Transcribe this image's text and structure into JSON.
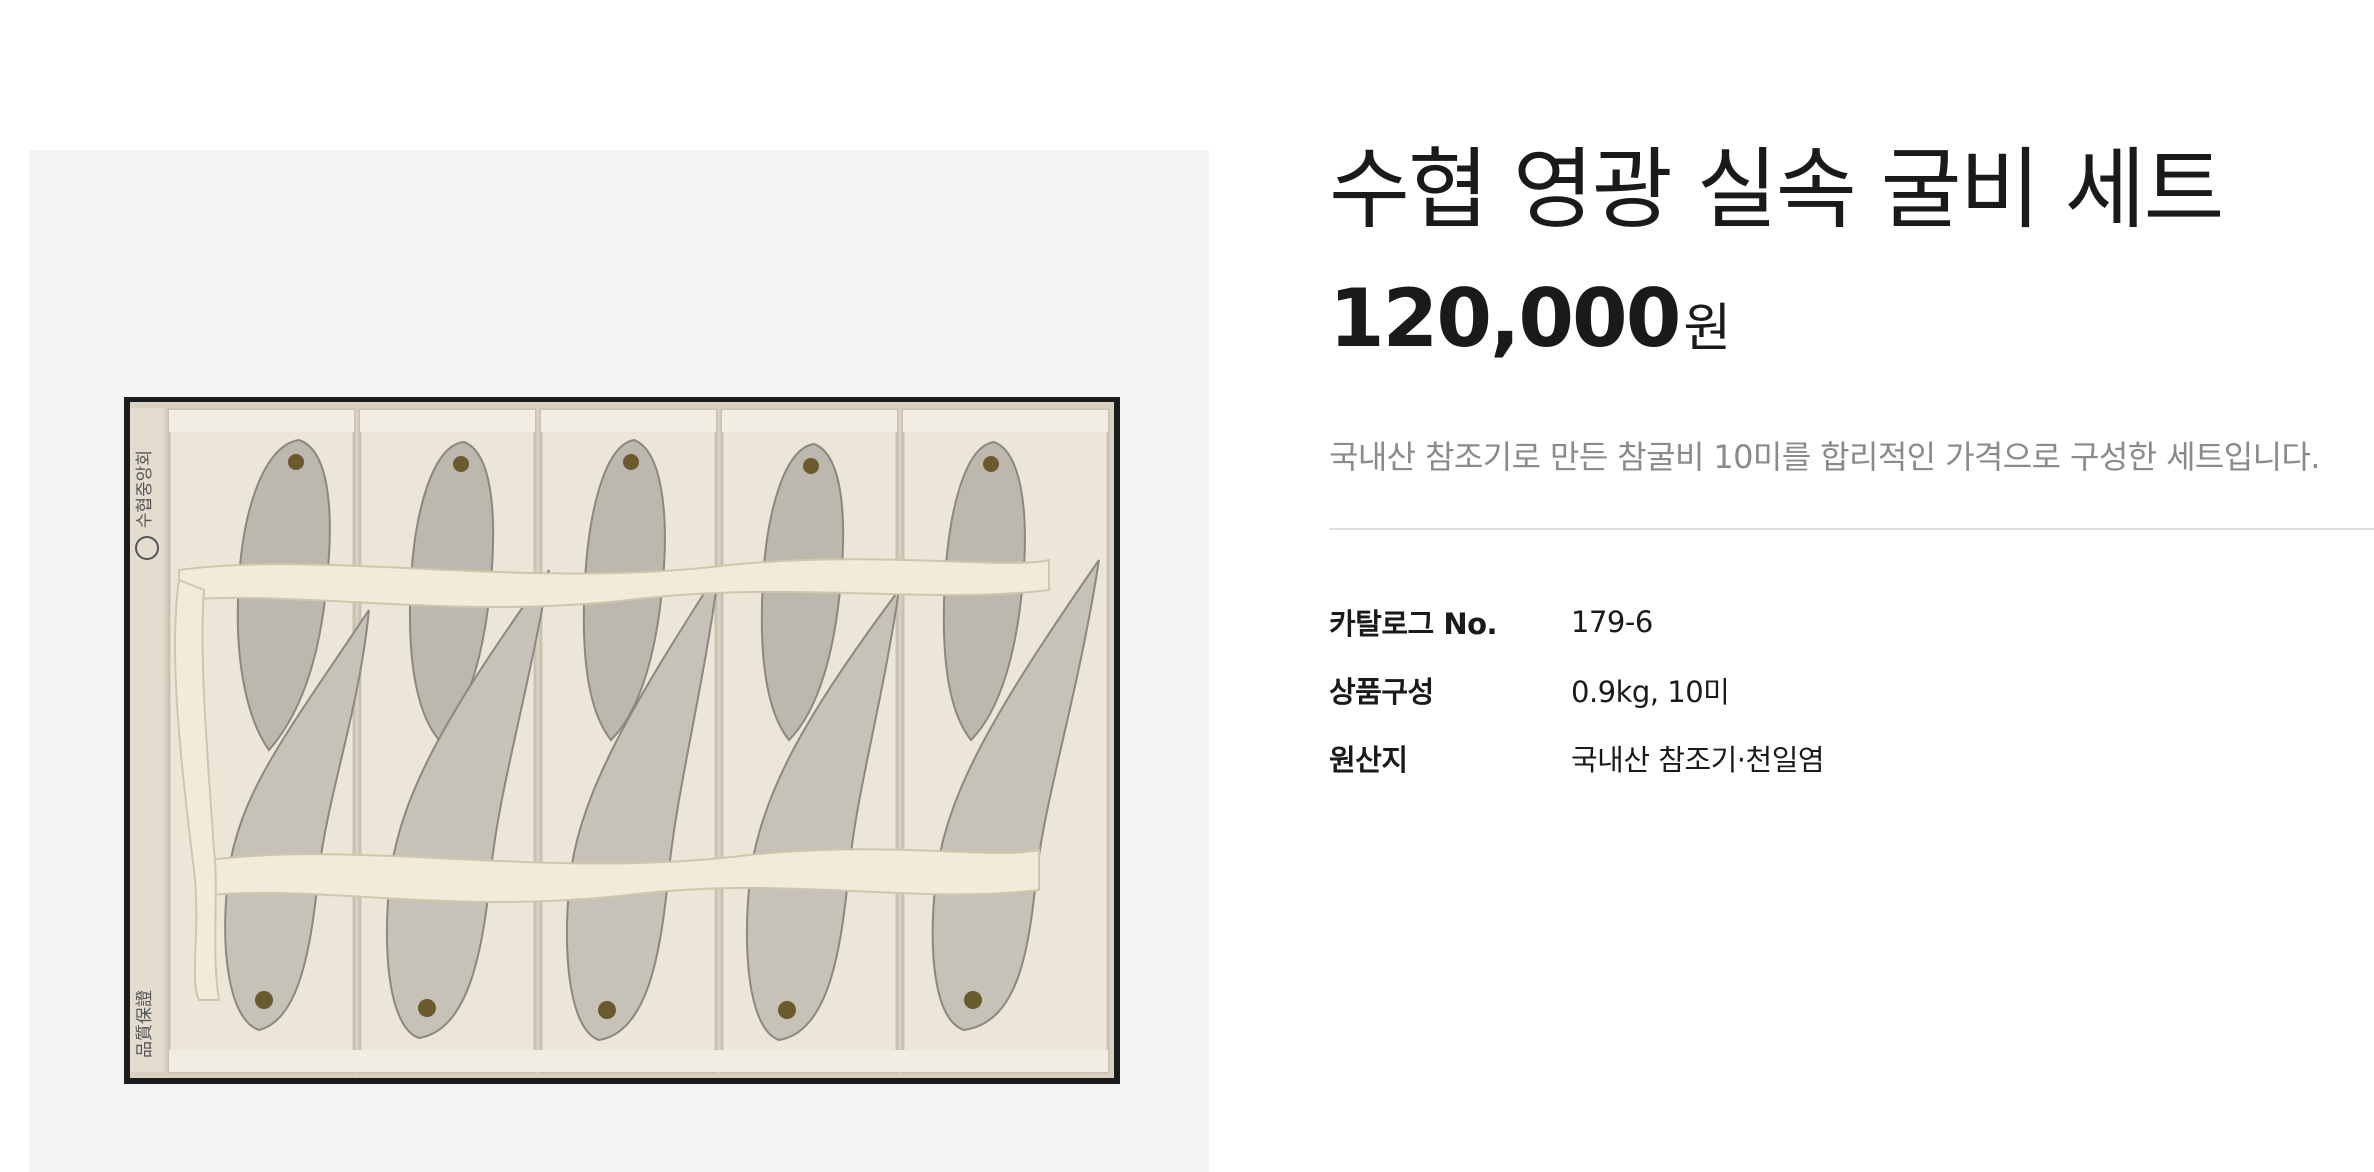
{
  "product": {
    "title": "수협 영광 실속 굴비 세트",
    "price_number": "120,000",
    "price_unit": "원",
    "description": "국내산 참조기로 만든 참굴비 10미를 합리적인 가격으로 구성한 세트입니다.",
    "image_box_text_top": "수협중앙회",
    "image_box_text_bottom": "品質保證"
  },
  "specs": [
    {
      "label": "카탈로그 No.",
      "value": "179-6"
    },
    {
      "label": "상품구성",
      "value": "0.9kg, 10미"
    },
    {
      "label": "원산지",
      "value": "국내산 참조기·천일염"
    }
  ],
  "colors": {
    "image_background": "#f3f3f3",
    "box_frame": "#1c1c1c",
    "box_inner": "#e9e3d6",
    "fish_body": "#b9b4aa",
    "fish_belly": "#d8d2c4",
    "rope": "#f1ecd9",
    "description_text": "#8a8a8a",
    "divider": "#dedede"
  }
}
